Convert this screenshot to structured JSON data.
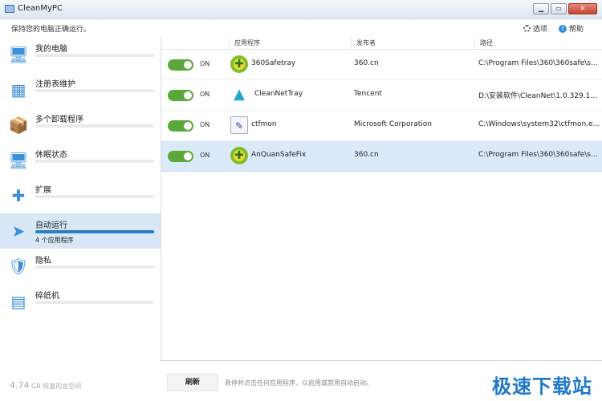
{
  "window": {
    "title": "CleanMyPC",
    "btn_min": "▁",
    "btn_max": "▭",
    "btn_close": "✕"
  },
  "header": {
    "subtitle": "保持您的电脑正确运行。",
    "options_label": "选项",
    "help_label": "帮助"
  },
  "sidebar": {
    "items": [
      {
        "label": "我的电脑",
        "icon": "monitor-icon",
        "glyph": "🖥"
      },
      {
        "label": "注册表维护",
        "icon": "registry-icon",
        "glyph": "▦"
      },
      {
        "label": "多个卸载程序",
        "icon": "uninstaller-icon",
        "glyph": "📦"
      },
      {
        "label": "休眠状态",
        "icon": "hibernation-icon",
        "glyph": "🖥"
      },
      {
        "label": "扩展",
        "icon": "puzzle-icon",
        "glyph": "✚"
      },
      {
        "label": "自动运行",
        "icon": "paper-plane-icon",
        "glyph": "➤",
        "sub": "4 个应用程序"
      },
      {
        "label": "隐私",
        "icon": "privacy-icon",
        "glyph": "🛡"
      },
      {
        "label": "碎纸机",
        "icon": "shredder-icon",
        "glyph": "▤"
      }
    ],
    "footer_amount": "4.74",
    "footer_text": "GB 恢复的总空间"
  },
  "table": {
    "headers": [
      "应用程序",
      "发布者",
      "路径"
    ],
    "rows": [
      {
        "state": "ON",
        "name": "360Safetray",
        "publisher": "360.cn",
        "path": "C:\\Program  Files\\360\\360safe\\s...",
        "icon": "360-safe-icon",
        "glyph": "✚"
      },
      {
        "state": "ON",
        "name": "CleanNetTray",
        "publisher": "Tencent",
        "path": "D:\\安装软件\\CleanNet\\1.0.329.1...",
        "icon": "cleannet-icon",
        "glyph": "▲"
      },
      {
        "state": "ON",
        "name": "ctfmon",
        "publisher": "Microsoft Corporation",
        "path": "C:\\Windows\\system32\\ctfmon.e...",
        "icon": "ctfmon-icon",
        "glyph": "✎"
      },
      {
        "state": "ON",
        "name": "AnQuanSafeFix",
        "publisher": "360.cn",
        "path": "C:\\Program  Files\\360\\360safe\\s...",
        "icon": "360-safe-icon",
        "glyph": "✚"
      }
    ]
  },
  "footer": {
    "refresh_label": "刷新",
    "hint": "悬停并点击任何应用程序，以启用或禁用自动启动。"
  },
  "watermark": "极速下载站"
}
